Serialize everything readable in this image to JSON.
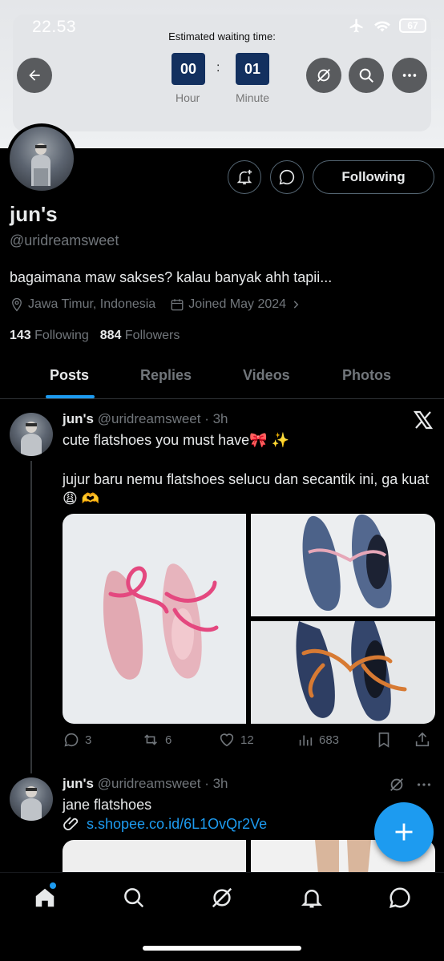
{
  "status_bar": {
    "time": "22.53",
    "battery": "67",
    "icons": [
      "airplane-icon",
      "wifi-icon",
      "battery-icon"
    ]
  },
  "waiting": {
    "title": "Estimated waiting time:",
    "hour_value": "00",
    "hour_label": "Hour",
    "separator": ":",
    "minute_value": "01",
    "minute_label": "Minute"
  },
  "profile": {
    "display_name": "jun's",
    "handle": "@uridreamsweet",
    "bio": "bagaimana maw sakses? kalau banyak ahh tapii...",
    "location": "Jawa Timur, Indonesia",
    "joined": "Joined May 2024",
    "following_count": "143",
    "following_label": "Following",
    "followers_count": "884",
    "followers_label": "Followers",
    "follow_button": "Following"
  },
  "tabs": [
    {
      "label": "Posts",
      "active": true
    },
    {
      "label": "Replies",
      "active": false
    },
    {
      "label": "Videos",
      "active": false
    },
    {
      "label": "Photos",
      "active": false
    }
  ],
  "tweets": [
    {
      "name": "jun's",
      "meta": "@uridreamsweet · 3h",
      "line1": "cute flatshoes you must have🎀 ✨",
      "line2": "jujur baru nemu flatshoes selucu dan secantik ini, ga kuat😩 🫶",
      "replies": "3",
      "reposts": "6",
      "likes": "12",
      "views": "683"
    },
    {
      "name": "jun's",
      "meta": "@uridreamsweet · 3h",
      "line1": "jane flatshoes",
      "link": "s.shopee.co.id/6L1OvQr2Ve"
    }
  ],
  "colors": {
    "accent": "#1d9bf0",
    "background": "#000000",
    "muted": "#71767b",
    "timer_box": "#13305f"
  }
}
